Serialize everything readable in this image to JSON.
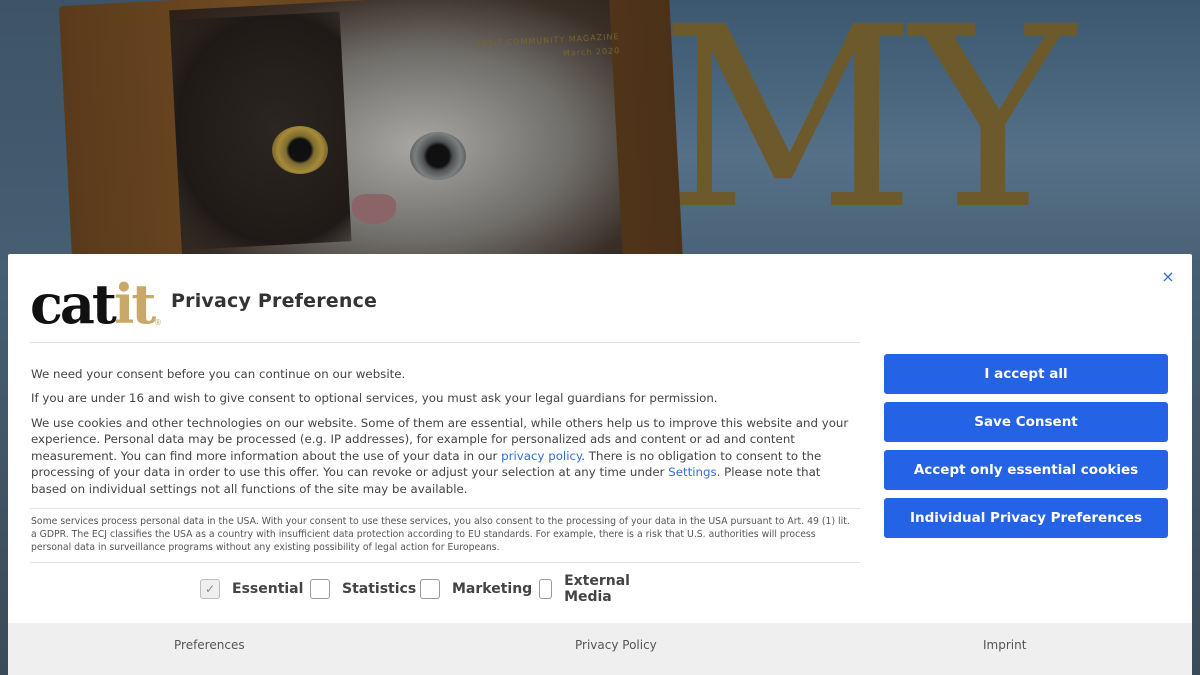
{
  "background": {
    "magazine_tag_line1": "CATIT COMMUNITY MAGAZINE",
    "magazine_tag_line2": "March 2020",
    "headline_large": "MY"
  },
  "dialog": {
    "logo_text_main": "cat",
    "logo_text_accent": "it",
    "logo_reg": "®",
    "title": "Privacy Preference",
    "close_symbol": "×",
    "para1": "We need your consent before you can continue on our website.",
    "para2": "If you are under 16 and wish to give consent to optional services, you must ask your legal guardians for permission.",
    "para3_a": "We use cookies and other technologies on our website. Some of them are essential, while others help us to improve this website and your experience. Personal data may be processed (e.g. IP addresses), for example for personalized ads and content or ad and content measurement. You can find more information about the use of your data in our ",
    "para3_link1": "privacy policy",
    "para3_b": ". There is no obligation to consent to the processing of your data in order to use this offer. You can revoke or adjust your selection at any time under ",
    "para3_link2": "Settings",
    "para3_c": ". Please note that based on individual settings not all functions of the site may be available.",
    "usa_notice": "Some services process personal data in the USA. With your consent to use these services, you also consent to the processing of your data in the USA pursuant to Art. 49 (1) lit. a GDPR. The ECJ classifies the USA as a country with insufficient data protection according to EU standards. For example, there is a risk that U.S. authorities will process personal data in surveillance programs without any existing possibility of legal action for Europeans.",
    "checkboxes": [
      {
        "label": "Essential",
        "checked": true,
        "disabled": true,
        "mark": "✓"
      },
      {
        "label": "Statistics",
        "checked": false
      },
      {
        "label": "Marketing",
        "checked": false
      },
      {
        "label": "External Media",
        "checked": false
      }
    ],
    "buttons": {
      "accept_all": "I accept all",
      "save_consent": "Save Consent",
      "accept_essential": "Accept only essential cookies",
      "individual_prefs": "Individual Privacy Preferences"
    },
    "footer": {
      "preferences": "Preferences",
      "privacy_policy": "Privacy Policy",
      "imprint": "Imprint"
    },
    "colors": {
      "accent": "#2563e6",
      "link": "#2f6fd6",
      "logo_gold": "#c8a96a"
    }
  }
}
